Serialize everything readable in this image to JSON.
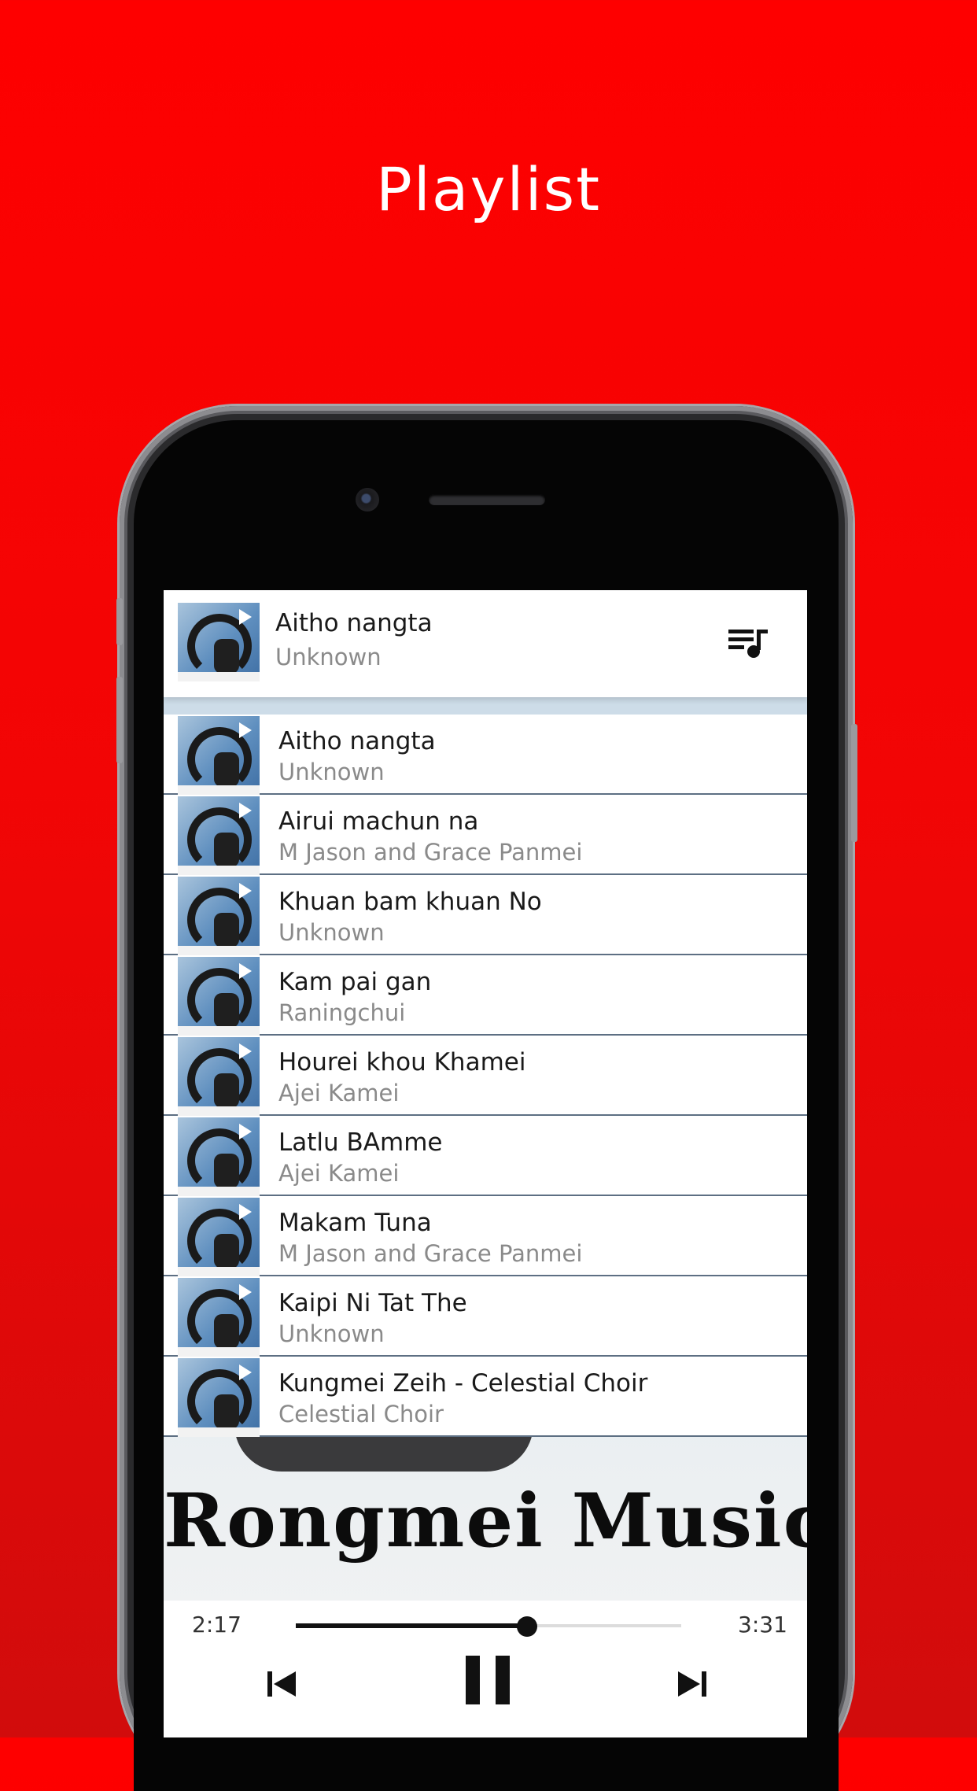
{
  "headline": "Playlist",
  "now_playing": {
    "title": "Aitho nangta",
    "artist": "Unknown"
  },
  "playlist": [
    {
      "title": "Aitho nangta",
      "artist": "Unknown"
    },
    {
      "title": "Airui machun na",
      "artist": "M Jason and Grace Panmei"
    },
    {
      "title": "Khuan bam khuan No",
      "artist": "Unknown"
    },
    {
      "title": "Kam pai gan",
      "artist": "Raningchui"
    },
    {
      "title": "Hourei khou Khamei",
      "artist": "Ajei Kamei"
    },
    {
      "title": "Latlu BAmme",
      "artist": "Ajei Kamei"
    },
    {
      "title": "Makam Tuna",
      "artist": "M Jason and Grace Panmei"
    },
    {
      "title": "Kaipi Ni Tat The",
      "artist": "Unknown"
    },
    {
      "title": "Kungmei Zeih - Celestial Choir",
      "artist": "Celestial Choir"
    }
  ],
  "brand": "Rongmei Music",
  "player": {
    "elapsed": "2:17",
    "duration": "3:31",
    "progress": 0.6
  },
  "icons": {
    "queue": "playlist-music-icon",
    "previous": "skip-previous-icon",
    "pause": "pause-icon",
    "next": "skip-next-icon"
  },
  "colors": {
    "background": "#fe0000",
    "accent": "#111111"
  }
}
